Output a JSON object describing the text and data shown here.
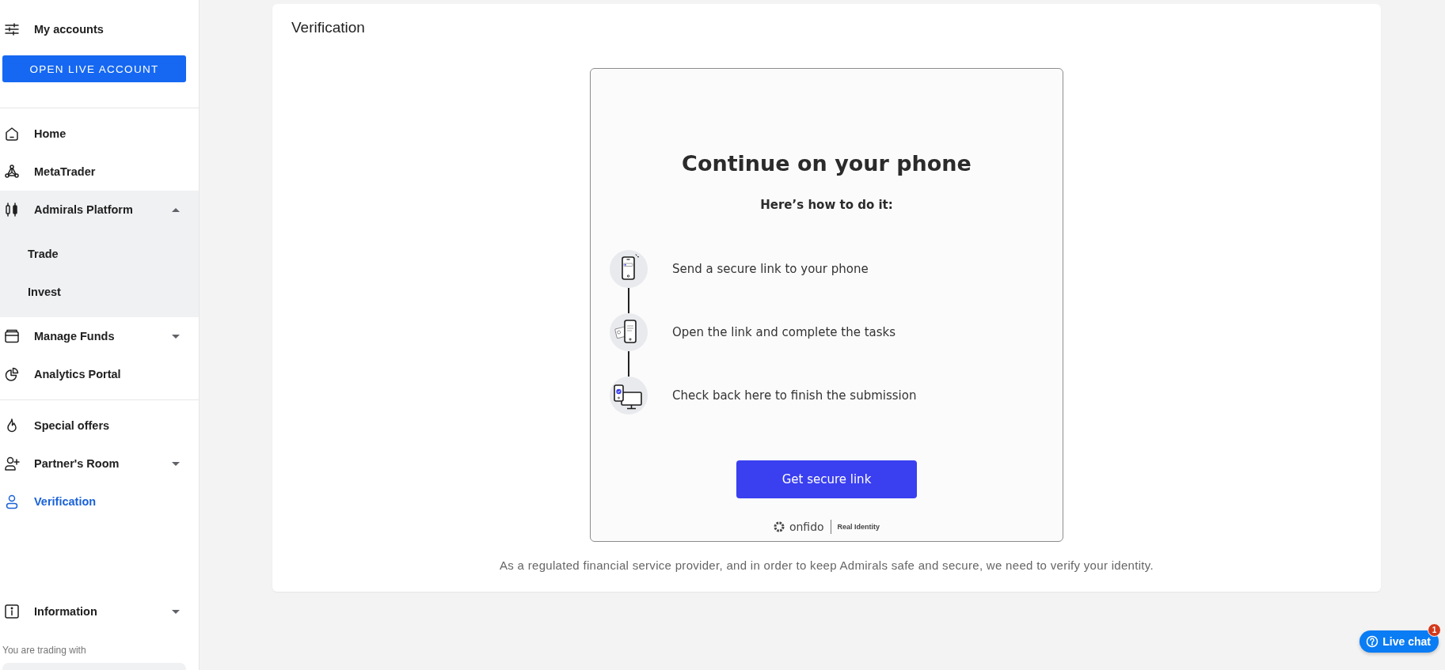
{
  "sidebar": {
    "accounts_label": "My accounts",
    "open_account_button": "OPEN LIVE ACCOUNT",
    "sections": [
      {
        "items": [
          {
            "label": "Home",
            "selected": false
          },
          {
            "label": "MetaTrader",
            "selected": false
          },
          {
            "label": "Admirals Platform",
            "selected": false,
            "expanded": true,
            "children": [
              {
                "label": "Trade",
                "selected": false
              },
              {
                "label": "Invest",
                "selected": false
              }
            ]
          },
          {
            "label": "Manage Funds",
            "selected": false,
            "expanded": false
          },
          {
            "label": "Analytics Portal",
            "selected": false
          }
        ]
      },
      {
        "items": [
          {
            "label": "Special offers",
            "selected": false
          },
          {
            "label": "Partner's Room",
            "selected": false,
            "expanded": false
          },
          {
            "label": "Verification",
            "selected": true
          }
        ]
      },
      {
        "items": [
          {
            "label": "Information",
            "selected": false,
            "expanded": false
          }
        ]
      }
    ],
    "trading_with": "You are trading with"
  },
  "main": {
    "title": "Verification",
    "onfido": {
      "heading": "Continue on your phone",
      "subheading": "Here’s how to do it:",
      "steps": [
        {
          "text": "Send a secure link to your phone"
        },
        {
          "text": "Open the link and complete the tasks"
        },
        {
          "text": "Check back here to finish the submission"
        }
      ],
      "button": "Get secure link",
      "brand": "onfido",
      "tagline": "Real Identity"
    },
    "notice": "As a regulated financial service provider, and in order to keep Admirals safe and secure, we need to verify your identity."
  },
  "live_chat": {
    "label": "Live chat",
    "badge": "1"
  }
}
